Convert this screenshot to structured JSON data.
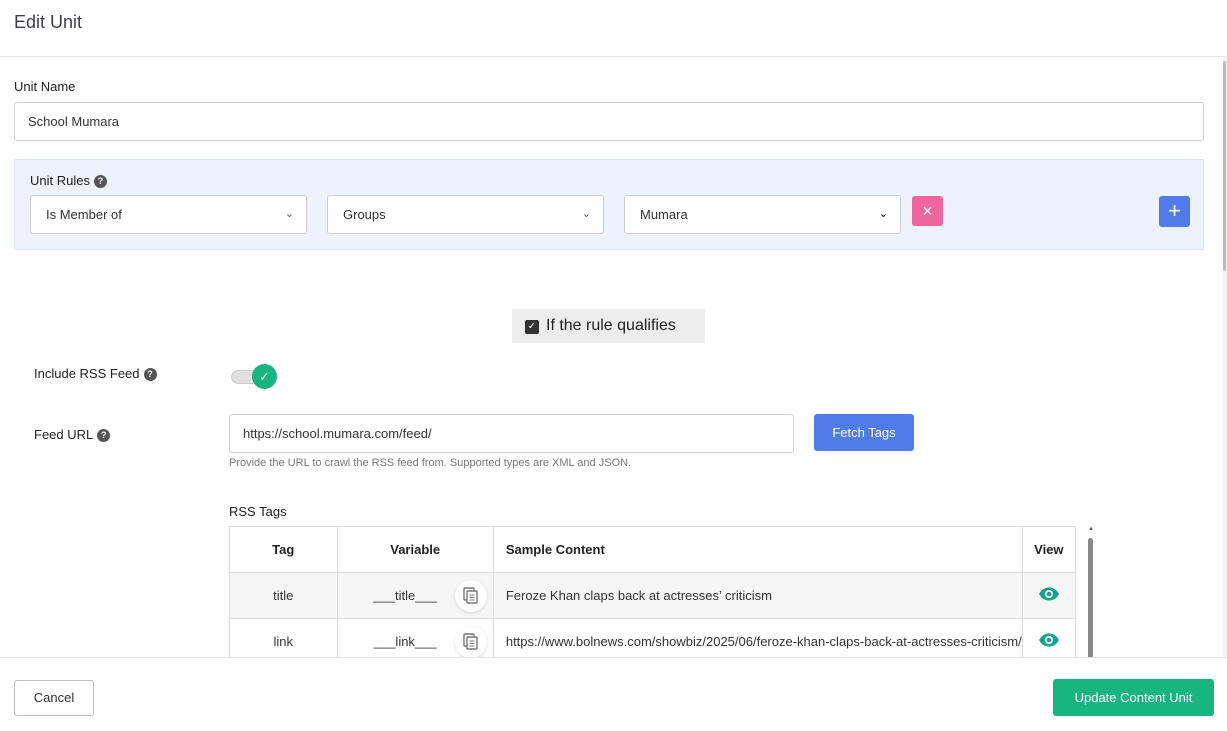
{
  "modal": {
    "title": "Edit Unit"
  },
  "unit_name": {
    "label": "Unit Name",
    "value": "School Mumara"
  },
  "unit_rules": {
    "label": "Unit Rules",
    "help_icon": "question-circle-icon",
    "rule": {
      "condition": "Is Member of",
      "field": "Groups",
      "value": "Mumara"
    },
    "remove_icon": "×",
    "add_icon": "+"
  },
  "qualify": {
    "label": "If the rule qualifies",
    "checked": true
  },
  "rss": {
    "include_label": "Include RSS Feed",
    "include_enabled": true,
    "feed_url_label": "Feed URL",
    "feed_url_value": "https://school.mumara.com/feed/",
    "fetch_label": "Fetch Tags",
    "hint": "Provide the URL to crawl the RSS feed from. Supported types are XML and JSON.",
    "tags_label": "RSS Tags",
    "table": {
      "headers": {
        "tag": "Tag",
        "variable": "Variable",
        "sample": "Sample Content",
        "view": "View"
      },
      "rows": [
        {
          "tag": "title",
          "variable": "___title___",
          "sample": "Feroze Khan claps back at actresses’ criticism"
        },
        {
          "tag": "link",
          "variable": "___link___",
          "sample": "https://www.bolnews.com/showbiz/2025/06/feroze-khan-claps-back-at-actresses-criticism/"
        }
      ]
    }
  },
  "footer": {
    "cancel_label": "Cancel",
    "update_label": "Update Content Unit"
  },
  "colors": {
    "primary": "#4f7ce8",
    "success": "#17b680",
    "danger": "#f0659c",
    "rules_bg": "#edf2fc"
  }
}
